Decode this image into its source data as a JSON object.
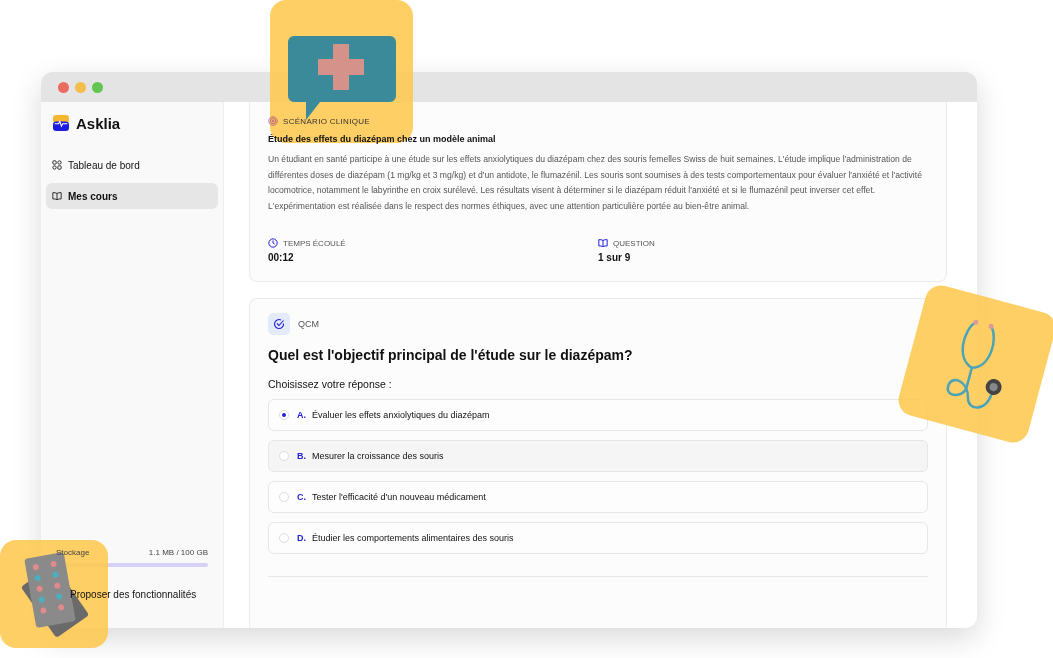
{
  "brand": {
    "name": "Asklia"
  },
  "sidebar": {
    "items": [
      {
        "label": "Tableau de bord",
        "selected": false
      },
      {
        "label": "Mes cours",
        "selected": true
      }
    ],
    "storage": {
      "label": "Stockage",
      "reading": "1.1 MB / 100 GB",
      "level": 0.01
    },
    "feedback_link": "Proposer des fonctionnalités"
  },
  "scenario": {
    "tag": "SCÉNARIO CLINIQUE",
    "title": "Étude des effets du diazépam chez un modèle animal",
    "text": "Un étudiant en santé participe à une étude sur les effets anxiolytiques du diazépam chez des souris femelles Swiss de huit semaines. L'étude implique l'administration de différentes doses de diazépam (1 mg/kg et 3 mg/kg) et d'un antidote, le flumazénil. Les souris sont soumises à des tests comportementaux pour évaluer l'anxiété et l'activité locomotrice, notamment le labyrinthe en croix surélevé. Les résultats visent à déterminer si le diazépam réduit l'anxiété et si le flumazénil peut inverser cet effet. L'expérimentation est réalisée dans le respect des normes éthiques, avec une attention particulière portée au bien-être animal.",
    "stats": [
      {
        "label": "TEMPS ÉCOULÉ",
        "value": "00:12"
      },
      {
        "label": "QUESTION",
        "value": "1 sur 9"
      }
    ]
  },
  "question": {
    "type": "QCM",
    "text": "Quel est l'objectif principal de l'étude sur le diazépam?",
    "prompt": "Choisissez votre réponse :",
    "options": [
      {
        "letter": "A.",
        "text": "Évaluer les effets anxiolytiques du diazépam",
        "selected": true
      },
      {
        "letter": "B.",
        "text": "Mesurer la croissance des souris",
        "selected": false
      },
      {
        "letter": "C.",
        "text": "Tester l'efficacité d'un nouveau médicament",
        "selected": false
      },
      {
        "letter": "D.",
        "text": "Étudier les comportements alimentaires des souris",
        "selected": false
      }
    ]
  }
}
